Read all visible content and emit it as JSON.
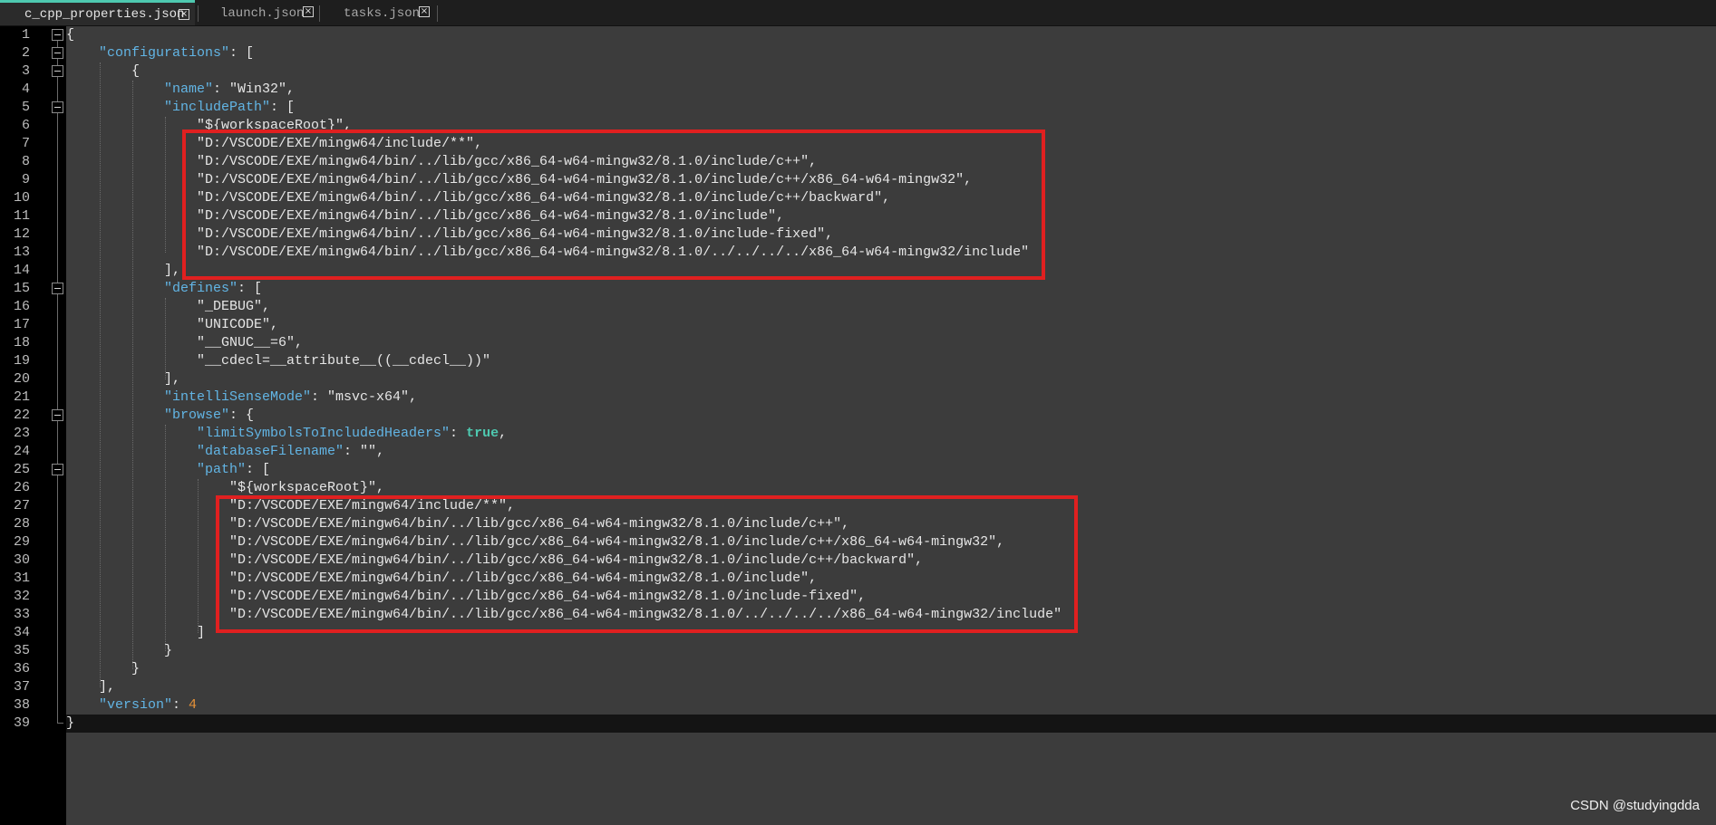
{
  "tabs": [
    {
      "label": "c_cpp_properties.json",
      "active": true
    },
    {
      "label": "launch.json",
      "active": false
    },
    {
      "label": "tasks.json",
      "active": false
    }
  ],
  "tab_close_glyph": "×",
  "lines": [
    {
      "n": "1",
      "indent": 0,
      "tokens": [
        [
          "pun",
          "{"
        ]
      ]
    },
    {
      "n": "2",
      "indent": 1,
      "tokens": [
        [
          "key",
          "\"configurations\""
        ],
        [
          "pun",
          ": ["
        ]
      ]
    },
    {
      "n": "3",
      "indent": 2,
      "tokens": [
        [
          "pun",
          "{"
        ]
      ]
    },
    {
      "n": "4",
      "indent": 3,
      "tokens": [
        [
          "key",
          "\"name\""
        ],
        [
          "pun",
          ": "
        ],
        [
          "str",
          "\"Win32\""
        ],
        [
          "pun",
          ","
        ]
      ]
    },
    {
      "n": "5",
      "indent": 3,
      "tokens": [
        [
          "key",
          "\"includePath\""
        ],
        [
          "pun",
          ": ["
        ]
      ]
    },
    {
      "n": "6",
      "indent": 4,
      "tokens": [
        [
          "str",
          "\"${workspaceRoot}\""
        ],
        [
          "pun",
          ","
        ]
      ]
    },
    {
      "n": "7",
      "indent": 4,
      "tokens": [
        [
          "str",
          "\"D:/VSCODE/EXE/mingw64/include/**\""
        ],
        [
          "pun",
          ","
        ]
      ]
    },
    {
      "n": "8",
      "indent": 4,
      "tokens": [
        [
          "str",
          "\"D:/VSCODE/EXE/mingw64/bin/../lib/gcc/x86_64-w64-mingw32/8.1.0/include/c++\""
        ],
        [
          "pun",
          ","
        ]
      ]
    },
    {
      "n": "9",
      "indent": 4,
      "tokens": [
        [
          "str",
          "\"D:/VSCODE/EXE/mingw64/bin/../lib/gcc/x86_64-w64-mingw32/8.1.0/include/c++/x86_64-w64-mingw32\""
        ],
        [
          "pun",
          ","
        ]
      ]
    },
    {
      "n": "10",
      "indent": 4,
      "tokens": [
        [
          "str",
          "\"D:/VSCODE/EXE/mingw64/bin/../lib/gcc/x86_64-w64-mingw32/8.1.0/include/c++/backward\""
        ],
        [
          "pun",
          ","
        ]
      ]
    },
    {
      "n": "11",
      "indent": 4,
      "tokens": [
        [
          "str",
          "\"D:/VSCODE/EXE/mingw64/bin/../lib/gcc/x86_64-w64-mingw32/8.1.0/include\""
        ],
        [
          "pun",
          ","
        ]
      ]
    },
    {
      "n": "12",
      "indent": 4,
      "tokens": [
        [
          "str",
          "\"D:/VSCODE/EXE/mingw64/bin/../lib/gcc/x86_64-w64-mingw32/8.1.0/include-fixed\""
        ],
        [
          "pun",
          ","
        ]
      ]
    },
    {
      "n": "13",
      "indent": 4,
      "tokens": [
        [
          "str",
          "\"D:/VSCODE/EXE/mingw64/bin/../lib/gcc/x86_64-w64-mingw32/8.1.0/../../../../x86_64-w64-mingw32/include\""
        ]
      ]
    },
    {
      "n": "14",
      "indent": 3,
      "tokens": [
        [
          "pun",
          "],"
        ]
      ]
    },
    {
      "n": "15",
      "indent": 3,
      "tokens": [
        [
          "key",
          "\"defines\""
        ],
        [
          "pun",
          ": ["
        ]
      ]
    },
    {
      "n": "16",
      "indent": 4,
      "tokens": [
        [
          "str",
          "\"_DEBUG\""
        ],
        [
          "pun",
          ","
        ]
      ]
    },
    {
      "n": "17",
      "indent": 4,
      "tokens": [
        [
          "str",
          "\"UNICODE\""
        ],
        [
          "pun",
          ","
        ]
      ]
    },
    {
      "n": "18",
      "indent": 4,
      "tokens": [
        [
          "str",
          "\"__GNUC__=6\""
        ],
        [
          "pun",
          ","
        ]
      ]
    },
    {
      "n": "19",
      "indent": 4,
      "tokens": [
        [
          "str",
          "\"__cdecl=__attribute__((__cdecl__))\""
        ]
      ]
    },
    {
      "n": "20",
      "indent": 3,
      "tokens": [
        [
          "pun",
          "],"
        ]
      ]
    },
    {
      "n": "21",
      "indent": 3,
      "tokens": [
        [
          "key",
          "\"intelliSenseMode\""
        ],
        [
          "pun",
          ": "
        ],
        [
          "str",
          "\"msvc-x64\""
        ],
        [
          "pun",
          ","
        ]
      ]
    },
    {
      "n": "22",
      "indent": 3,
      "tokens": [
        [
          "key",
          "\"browse\""
        ],
        [
          "pun",
          ": {"
        ]
      ]
    },
    {
      "n": "23",
      "indent": 4,
      "tokens": [
        [
          "key",
          "\"limitSymbolsToIncludedHeaders\""
        ],
        [
          "pun",
          ": "
        ],
        [
          "kw",
          "true"
        ],
        [
          "pun",
          ","
        ]
      ]
    },
    {
      "n": "24",
      "indent": 4,
      "tokens": [
        [
          "key",
          "\"databaseFilename\""
        ],
        [
          "pun",
          ": "
        ],
        [
          "str",
          "\"\""
        ],
        [
          "pun",
          ","
        ]
      ]
    },
    {
      "n": "25",
      "indent": 4,
      "tokens": [
        [
          "key",
          "\"path\""
        ],
        [
          "pun",
          ": ["
        ]
      ]
    },
    {
      "n": "26",
      "indent": 5,
      "tokens": [
        [
          "str",
          "\"${workspaceRoot}\""
        ],
        [
          "pun",
          ","
        ]
      ]
    },
    {
      "n": "27",
      "indent": 5,
      "tokens": [
        [
          "str",
          "\"D:/VSCODE/EXE/mingw64/include/**\""
        ],
        [
          "pun",
          ","
        ]
      ]
    },
    {
      "n": "28",
      "indent": 5,
      "tokens": [
        [
          "str",
          "\"D:/VSCODE/EXE/mingw64/bin/../lib/gcc/x86_64-w64-mingw32/8.1.0/include/c++\""
        ],
        [
          "pun",
          ","
        ]
      ]
    },
    {
      "n": "29",
      "indent": 5,
      "tokens": [
        [
          "str",
          "\"D:/VSCODE/EXE/mingw64/bin/../lib/gcc/x86_64-w64-mingw32/8.1.0/include/c++/x86_64-w64-mingw32\""
        ],
        [
          "pun",
          ","
        ]
      ]
    },
    {
      "n": "30",
      "indent": 5,
      "tokens": [
        [
          "str",
          "\"D:/VSCODE/EXE/mingw64/bin/../lib/gcc/x86_64-w64-mingw32/8.1.0/include/c++/backward\""
        ],
        [
          "pun",
          ","
        ]
      ]
    },
    {
      "n": "31",
      "indent": 5,
      "tokens": [
        [
          "str",
          "\"D:/VSCODE/EXE/mingw64/bin/../lib/gcc/x86_64-w64-mingw32/8.1.0/include\""
        ],
        [
          "pun",
          ","
        ]
      ]
    },
    {
      "n": "32",
      "indent": 5,
      "tokens": [
        [
          "str",
          "\"D:/VSCODE/EXE/mingw64/bin/../lib/gcc/x86_64-w64-mingw32/8.1.0/include-fixed\""
        ],
        [
          "pun",
          ","
        ]
      ]
    },
    {
      "n": "33",
      "indent": 5,
      "tokens": [
        [
          "str",
          "\"D:/VSCODE/EXE/mingw64/bin/../lib/gcc/x86_64-w64-mingw32/8.1.0/../../../../x86_64-w64-mingw32/include\""
        ]
      ]
    },
    {
      "n": "34",
      "indent": 4,
      "tokens": [
        [
          "pun",
          "]"
        ]
      ]
    },
    {
      "n": "35",
      "indent": 3,
      "tokens": [
        [
          "pun",
          "}"
        ]
      ]
    },
    {
      "n": "36",
      "indent": 2,
      "tokens": [
        [
          "pun",
          "}"
        ]
      ]
    },
    {
      "n": "37",
      "indent": 1,
      "tokens": [
        [
          "pun",
          "],"
        ]
      ]
    },
    {
      "n": "38",
      "indent": 1,
      "tokens": [
        [
          "key",
          "\"version\""
        ],
        [
          "pun",
          ": "
        ],
        [
          "num",
          "4"
        ]
      ]
    },
    {
      "n": "39",
      "indent": 0,
      "tokens": [
        [
          "pun",
          "}"
        ]
      ]
    }
  ],
  "colors": {
    "key": "#62b5e5",
    "keyword": "#4ec9b0",
    "number": "#e69138",
    "highlight_box": "#e02020",
    "editor_bg": "#3c3c3c"
  },
  "watermark": "CSDN @studyingdda"
}
